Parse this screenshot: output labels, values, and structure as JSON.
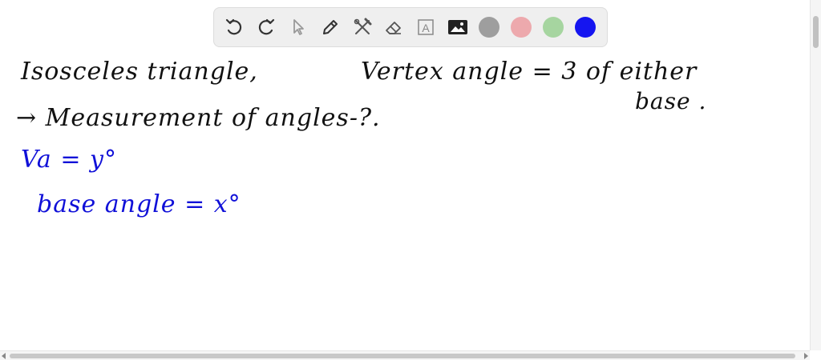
{
  "toolbar": {
    "tools": [
      {
        "name": "undo-icon"
      },
      {
        "name": "redo-icon"
      },
      {
        "name": "pointer-icon"
      },
      {
        "name": "pen-icon"
      },
      {
        "name": "tools-icon"
      },
      {
        "name": "eraser-icon"
      },
      {
        "name": "text-icon",
        "glyph": "A"
      },
      {
        "name": "image-icon"
      }
    ],
    "colors": [
      {
        "name": "gray",
        "hex": "#9e9e9e"
      },
      {
        "name": "pink",
        "hex": "#eda9ad"
      },
      {
        "name": "green",
        "hex": "#a6d5a0"
      },
      {
        "name": "blue",
        "hex": "#1515f0"
      }
    ]
  },
  "canvas": {
    "line1_left": "Isosceles triangle,",
    "line1_right": "Vertex angle = 3 of either",
    "line1_base": "base .",
    "line2": "→ Measurement of angles-?.",
    "line3": "Va = y°",
    "line4": "base angle = x°",
    "ink_black": "#111111",
    "ink_blue": "#1010d8"
  }
}
